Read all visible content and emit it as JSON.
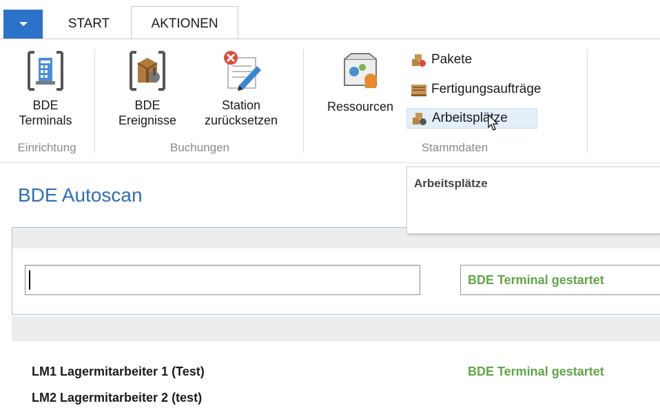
{
  "tabs": [
    {
      "label": "START"
    },
    {
      "label": "AKTIONEN"
    }
  ],
  "ribbon": {
    "einrichtung": {
      "label": "Einrichtung",
      "bde_terminals": {
        "line1": "BDE",
        "line2": "Terminals",
        "icon": "terminal-icon"
      }
    },
    "buchungen": {
      "label": "Buchungen",
      "bde_ereignisse": {
        "line1": "BDE",
        "line2": "Ereignisse",
        "icon": "events-icon"
      },
      "station_reset": {
        "line1": "Station",
        "line2": "zurücksetzen",
        "icon": "station-reset-icon"
      }
    },
    "stammdaten": {
      "label": "Stammdaten",
      "ressourcen": {
        "label": "Ressourcen",
        "icon": "resources-icon"
      },
      "pakete": {
        "label": "Pakete"
      },
      "fertigungsauftraege": {
        "label": "Fertigungsaufträge"
      },
      "arbeitsplaetze": {
        "label": "Arbeitsplätze"
      }
    }
  },
  "tooltip": {
    "title": "Arbeitsplätze"
  },
  "page": {
    "title": "BDE Autoscan",
    "scan_input": {
      "value": "",
      "placeholder": ""
    },
    "status": "BDE Terminal gestartet"
  },
  "rows": [
    {
      "name": "LM1 Lagermitarbeiter 1 (Test)",
      "status": "BDE Terminal gestartet"
    },
    {
      "name": "LM2 Lagermitarbeiter 2 (test)",
      "status": ""
    }
  ],
  "colors": {
    "accent": "#2b72c9",
    "title": "#2d6db5",
    "status_green": "#5fa644"
  }
}
